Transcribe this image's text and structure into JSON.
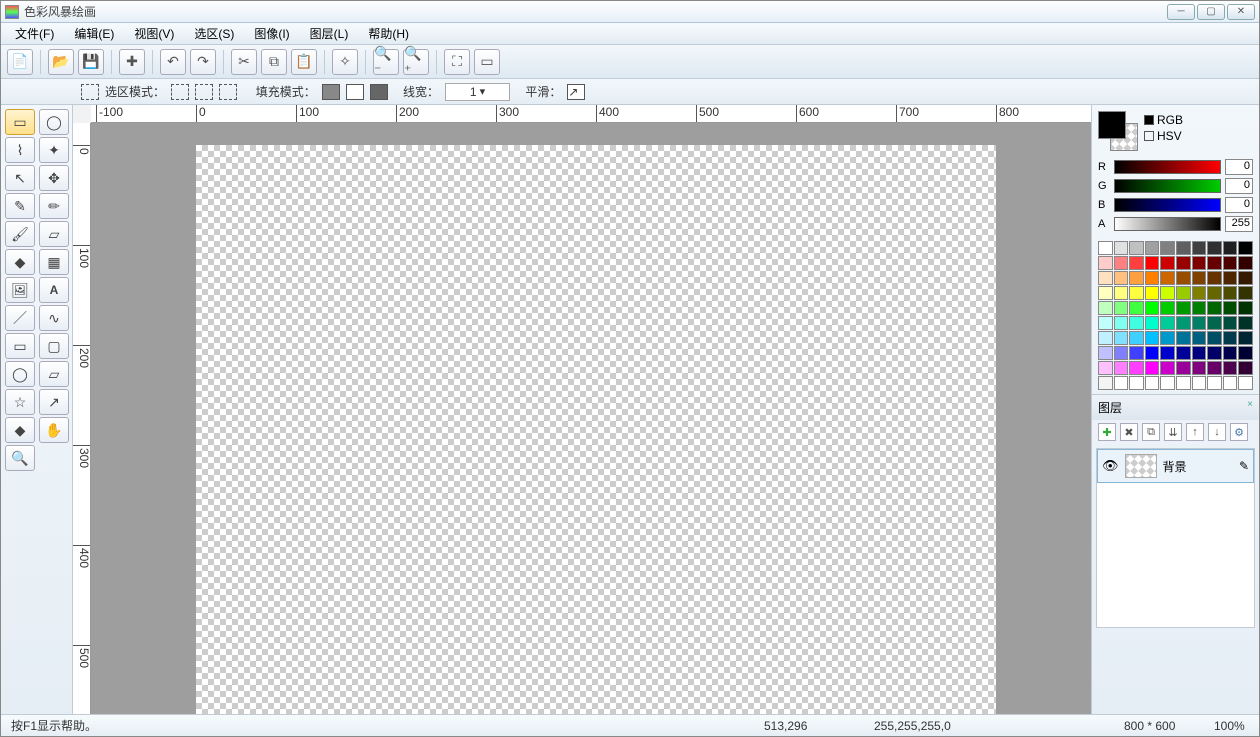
{
  "title": "色彩风暴绘画",
  "menu": [
    "文件(F)",
    "编辑(E)",
    "视图(V)",
    "选区(S)",
    "图像(I)",
    "图层(L)",
    "帮助(H)"
  ],
  "options": {
    "sel_mode_label": "选区模式：",
    "fill_mode_label": "填充模式：",
    "linewidth_label": "线宽：",
    "linewidth_value": "1",
    "smooth_label": "平滑："
  },
  "ruler_h": [
    "-100",
    "0",
    "100",
    "200",
    "300",
    "400",
    "500",
    "600",
    "700",
    "800"
  ],
  "ruler_v": [
    "0",
    "100",
    "200",
    "300",
    "400",
    "500"
  ],
  "color_mode": {
    "rgb": "RGB",
    "hsv": "HSV"
  },
  "sliders": {
    "R": "0",
    "G": "0",
    "B": "0",
    "A": "255"
  },
  "palette": [
    "#ffffff",
    "#e0e0e0",
    "#c0c0c0",
    "#a0a0a0",
    "#808080",
    "#606060",
    "#404040",
    "#303030",
    "#202020",
    "#000000",
    "#ffcccc",
    "#ff8080",
    "#ff4040",
    "#ff0000",
    "#cc0000",
    "#990000",
    "#800000",
    "#660000",
    "#4d0000",
    "#330000",
    "#ffe0c0",
    "#ffc080",
    "#ffa040",
    "#ff8000",
    "#cc6600",
    "#994d00",
    "#804000",
    "#663300",
    "#4d2600",
    "#331a00",
    "#ffffc0",
    "#ffff80",
    "#ffff40",
    "#ffff00",
    "#ccff00",
    "#99cc00",
    "#808000",
    "#666600",
    "#4d4d00",
    "#333300",
    "#c0ffc0",
    "#80ff80",
    "#40ff40",
    "#00ff00",
    "#00cc00",
    "#009900",
    "#008000",
    "#006600",
    "#004d00",
    "#003300",
    "#c0fffb",
    "#80fff0",
    "#40ffe0",
    "#00ffcc",
    "#00cc99",
    "#009973",
    "#008066",
    "#00664d",
    "#004d40",
    "#003328",
    "#c0f0ff",
    "#80e0ff",
    "#40d0ff",
    "#00c0ff",
    "#0099cc",
    "#007399",
    "#006080",
    "#004d66",
    "#003a4d",
    "#002633",
    "#c0c0ff",
    "#8080ff",
    "#4040ff",
    "#0000ff",
    "#0000cc",
    "#000099",
    "#000080",
    "#000066",
    "#00004d",
    "#000033",
    "#ffc0ff",
    "#ff80ff",
    "#ff40ff",
    "#ff00ff",
    "#cc00cc",
    "#990099",
    "#800080",
    "#660066",
    "#4d004d",
    "#330033",
    "#f4f4f4",
    "#ffffff",
    "#ffffff",
    "#ffffff",
    "#ffffff",
    "#ffffff",
    "#ffffff",
    "#ffffff",
    "#ffffff",
    "#ffffff"
  ],
  "layers_panel": {
    "title": "图层",
    "layer0": "背景"
  },
  "status": {
    "help": "按F1显示帮助。",
    "coords": "513,296",
    "pixel": "255,255,255,0",
    "dim": "800 * 600",
    "zoom": "100%"
  }
}
